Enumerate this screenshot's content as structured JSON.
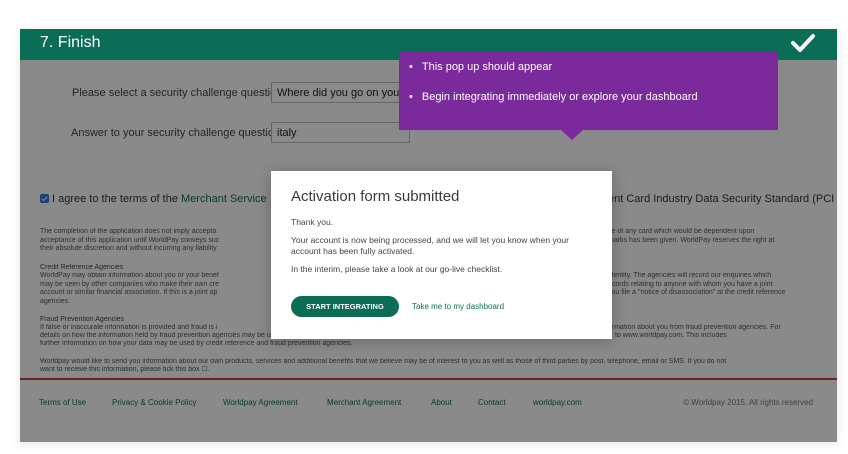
{
  "header": {
    "title": "7. Finish"
  },
  "form": {
    "security_question_label": "Please select a security challenge question:",
    "security_question_value": "Where did you go on your firs",
    "answer_label": "Answer to your security challenge question:",
    "answer_value": "italy",
    "agree_text": "I agree to the terms of the",
    "agree_link": "Merchant Service",
    "agree_right": "ent Card Industry Data Security Standard (PCI",
    "para1_left": "The completion of the application does not imply accepta\nacceptance of this application until WorldPay conveys suc\ntheir absolute discretion and without incurring any liability",
    "para1_right": "ce of any card which would be dependent upon\nmarks has been given. WorldPay reserves the right at",
    "credit_heading": "Credit Reference Agencies",
    "credit_left": "WorldPay may obtain information about you or your benef\nmay be seen by other companies who make their own cre\naccount or similar financial association. If this is a joint ap\nagencies.",
    "credit_right": "identity. The agencies will record our enquiries which\necords relating to anyone with whom you have a joint\nyou file a \"notice of disassociation\" at the credit reference",
    "fraud_heading": "Fraud Prevention Agencies",
    "fraud_left": "If false or inaccurate information is provided and fraud is i",
    "fraud_right": "ormation about you from fraud prevention agencies. For",
    "fraud_line2": "details on how the information held by fraud prevention agencies may be used, please refer to the Merchant Services Agreement. For the up to date Worldpay Privacy Policy please refer to www.worldpay.com. This includes",
    "fraud_line3": "further information on how your data may be used by credit reference and fraud prevention agencies.",
    "marketing_line1": "Worldpay would like to send you information about our own products, services and additional benefits that we believe may be of interest to you as well as those of third parties by post, telephone, email or SMS. If you do not",
    "marketing_line2": "want to receive this information, please tick this box ☐."
  },
  "footer": {
    "links": [
      "Terms of Use",
      "Privacy & Cookie Policy",
      "Worldpay Agreement",
      "Merchant Agreement",
      "About",
      "Contact",
      "worldpay.com"
    ],
    "copyright": "© Worldpay 2015. All rights reserved"
  },
  "dialog": {
    "title": "Activation form submitted",
    "thank_you": "Thank you.",
    "processing": "Your account is now being processed, and we will let you know when your account has been fully activated.",
    "interim": "In the interim, please take a look at our go-live checklist.",
    "primary_button": "START INTEGRATING",
    "secondary_link": "Take me to my dashboard"
  },
  "callout": {
    "bullets": [
      "This pop up should appear",
      "Begin integrating immediately or explore your dashboard"
    ],
    "bullet_char": "•"
  },
  "colors": {
    "brand_green": "#0c6d56",
    "callout_purple": "#7a2a9a",
    "footer_red": "#c94040",
    "overlay": "rgba(0,0,0,0.46)"
  }
}
